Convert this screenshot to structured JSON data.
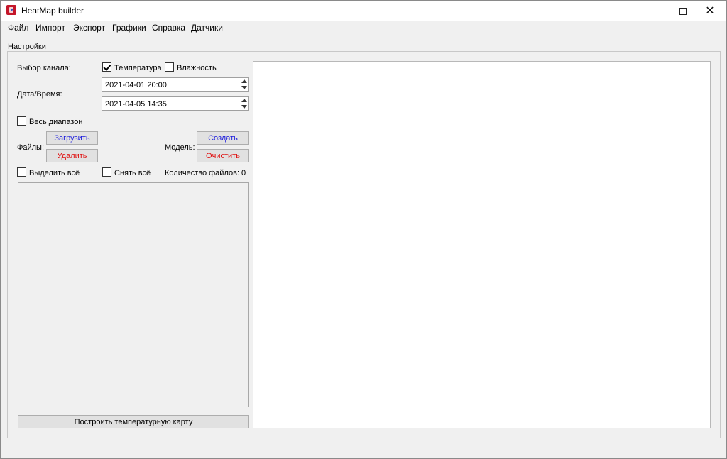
{
  "window": {
    "title": "HeatMap builder",
    "controls": {
      "minimize": "minimize-icon",
      "maximize": "maximize-icon",
      "close": "close-icon"
    }
  },
  "menu": {
    "file": "Файл",
    "import": "Импорт",
    "export": "Экспорт",
    "graphs": "Графики",
    "help": "Справка",
    "sensors": "Датчики"
  },
  "settings": {
    "group_title": "Настройки",
    "channel_label": "Выбор канала:",
    "temperature": {
      "label": "Температура",
      "checked": true
    },
    "humidity": {
      "label": "Влажность",
      "checked": false
    },
    "datetime_label": "Дата/Время:",
    "date_from": "2021-04-01 20:00",
    "date_to": "2021-04-05 14:35",
    "full_range": {
      "label": "Весь диапазон",
      "checked": false
    },
    "files_label": "Файлы:",
    "load_button": "Загрузить",
    "delete_button": "Удалить",
    "model_label": "Модель:",
    "create_button": "Создать",
    "clear_button": "Очистить",
    "select_all": {
      "label": "Выделить всё",
      "checked": false
    },
    "deselect_all": {
      "label": "Снять всё",
      "checked": false
    },
    "file_count_label": "Количество файлов: 0",
    "build_button": "Построить температурную карту"
  },
  "colors": {
    "blue_button_text": "#1a1adc",
    "red_button_text": "#e01010",
    "app_icon": "#c4162a"
  }
}
